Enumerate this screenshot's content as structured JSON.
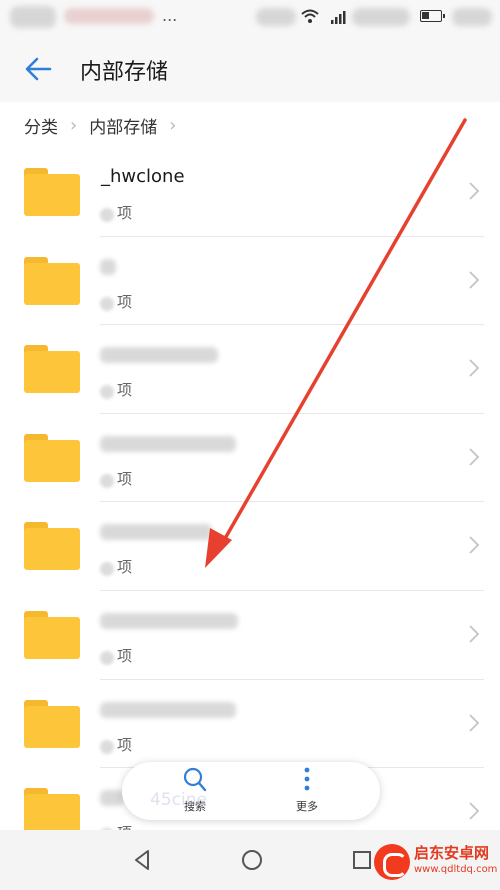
{
  "status_bar": {
    "dots": "..."
  },
  "app_bar": {
    "title": "内部存储",
    "back_icon": "arrow-left-icon"
  },
  "breadcrumb": {
    "items": [
      "分类",
      "内部存储"
    ]
  },
  "folders": [
    {
      "name": "_hwclone",
      "items_label": "项"
    },
    {
      "name": "",
      "items_label": "项"
    },
    {
      "name": "",
      "items_label": "项"
    },
    {
      "name": "",
      "items_label": "项"
    },
    {
      "name": "",
      "items_label": "项"
    },
    {
      "name": "",
      "items_label": "项"
    },
    {
      "name": "",
      "items_label": "项"
    },
    {
      "name": "",
      "items_label": "项"
    }
  ],
  "bottom_actions": {
    "search_label": "搜索",
    "more_label": "更多"
  },
  "watermark": "45cine",
  "logo": {
    "name": "启东安卓网",
    "url": "www.qdltdq.com"
  },
  "colors": {
    "accent": "#2f7fd9",
    "folder": "#fdc63a",
    "arrow": "#e8402e",
    "logo": "#e23a1f"
  }
}
